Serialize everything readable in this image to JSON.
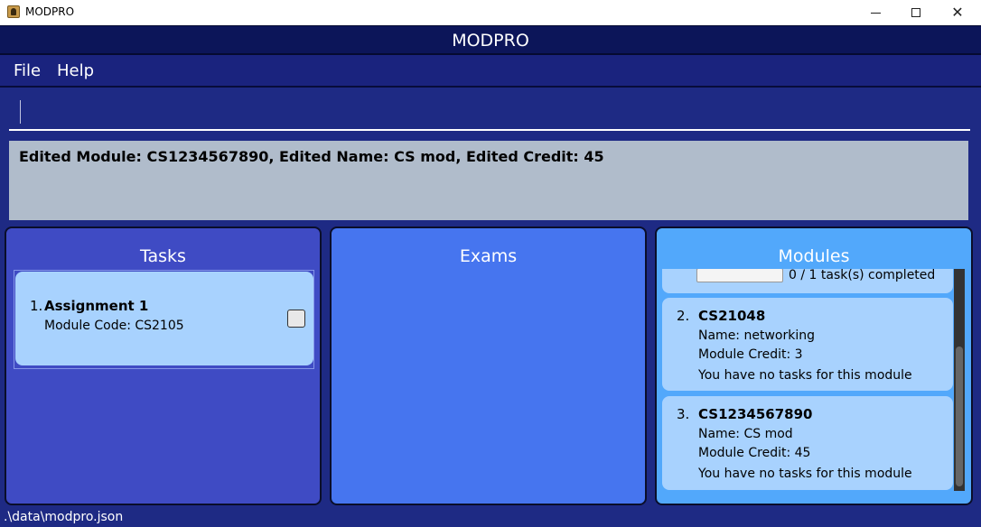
{
  "window": {
    "title": "MODPRO",
    "controls": [
      "minimize-icon",
      "maximize-icon",
      "close-icon"
    ]
  },
  "app": {
    "title": "MODPRO"
  },
  "menu": {
    "file": "File",
    "help": "Help"
  },
  "command": {
    "value": ""
  },
  "result": {
    "text": "Edited Module: CS1234567890, Edited Name: CS mod, Edited Credit: 45"
  },
  "panels": {
    "tasks": {
      "title": "Tasks",
      "items": [
        {
          "index": "1.",
          "name": "Assignment 1",
          "detail": "Module Code: CS2105",
          "done": false
        }
      ]
    },
    "exams": {
      "title": "Exams",
      "items": []
    },
    "modules": {
      "title": "Modules",
      "items": [
        {
          "progress_text": "0 / 1 task(s) completed",
          "progress_fraction": 0
        },
        {
          "index": "2.",
          "code": "CS21048",
          "name": "Name: networking",
          "credit": "Module Credit: 3",
          "tasks": "You have no tasks for this module"
        },
        {
          "index": "3.",
          "code": "CS1234567890",
          "name": "Name: CS mod",
          "credit": "Module Credit: 45",
          "tasks": "You have no tasks for this module"
        }
      ]
    }
  },
  "status": {
    "path": ".\\data\\modpro.json"
  },
  "colors": {
    "background": "#1e2a84",
    "header": "#0c1559",
    "tasks_panel": "#3f4bc4",
    "exams_panel": "#4675ef",
    "modules_panel": "#52a8fb",
    "card": "#a8d2fe",
    "result_box": "#b0bccb"
  }
}
